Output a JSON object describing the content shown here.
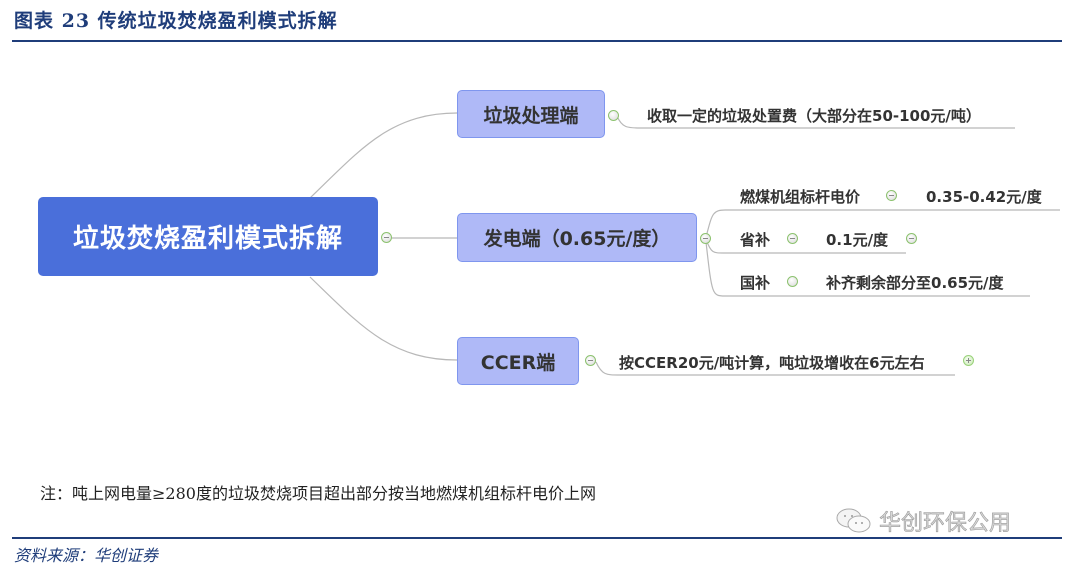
{
  "figure": {
    "title": "图表 23   传统垃圾焚烧盈利模式拆解",
    "note": "注：吨上网电量≥280度的垃圾焚烧项目超出部分按当地燃煤机组标杆电价上网",
    "source": "资料来源：华创证券",
    "watermark": "华创环保公用"
  },
  "mindmap": {
    "root": {
      "label": "垃圾焚烧盈利模式拆解",
      "color": "#4a6fda"
    },
    "branch_color": "#afb9f7",
    "branches": [
      {
        "label": "垃圾处理端",
        "children": [
          {
            "label": "收取一定的垃圾处置费（大部分在50-100元/吨）"
          }
        ]
      },
      {
        "label": "发电端（0.65元/度）",
        "children": [
          {
            "label": "燃煤机组标杆电价",
            "value": "0.35-0.42元/度"
          },
          {
            "label": "省补",
            "value": "0.1元/度"
          },
          {
            "label": "国补",
            "value": "补齐剩余部分至0.65元/度"
          }
        ]
      },
      {
        "label": "CCER端",
        "children": [
          {
            "label": "按CCER20元/吨计算，吨垃圾增收在6元左右"
          }
        ]
      }
    ]
  }
}
